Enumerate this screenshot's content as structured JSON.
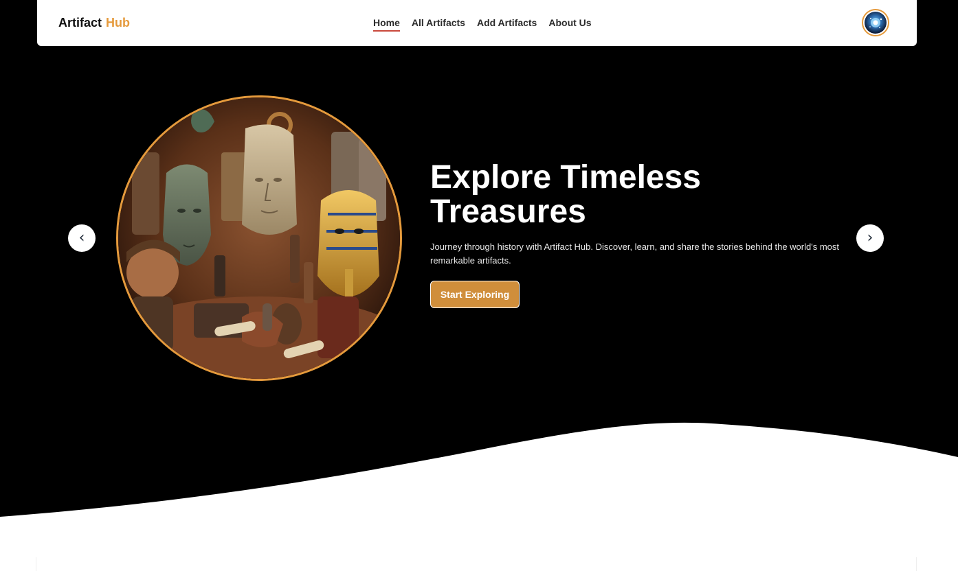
{
  "brand": {
    "name": "Artifact",
    "accent": "Hub"
  },
  "nav": {
    "links": [
      {
        "label": "Home",
        "active": true
      },
      {
        "label": "All Artifacts",
        "active": false
      },
      {
        "label": "Add Artifacts",
        "active": false
      },
      {
        "label": "About Us",
        "active": false
      }
    ]
  },
  "user": {
    "avatar_icon": "user-avatar-icon"
  },
  "slider": {
    "prev_glyph": "‹",
    "next_glyph": "›"
  },
  "hero": {
    "title": "Explore Timeless Treasures",
    "description": "Journey through history with Artifact Hub. Discover, learn, and share the stories behind the world's most remarkable artifacts.",
    "cta_label": "Start Exploring",
    "image_icon": "artifacts-collage-image"
  },
  "colors": {
    "accent": "#e59a3c",
    "cta": "#d08e3b",
    "active_underline": "#c9483b",
    "hero_bg": "#000000"
  }
}
